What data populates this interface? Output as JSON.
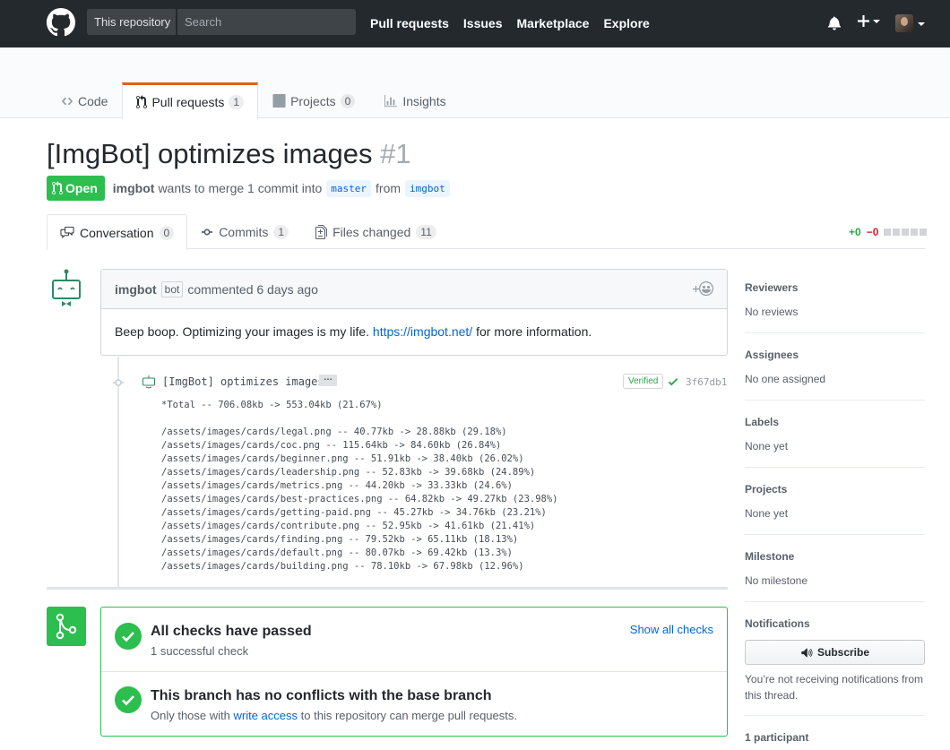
{
  "header": {
    "scope_label": "This repository",
    "search_placeholder": "Search",
    "nav": [
      "Pull requests",
      "Issues",
      "Marketplace",
      "Explore"
    ]
  },
  "repo_tabs": [
    {
      "label": "Code",
      "count": null
    },
    {
      "label": "Pull requests",
      "count": "1"
    },
    {
      "label": "Projects",
      "count": "0"
    },
    {
      "label": "Insights",
      "count": null
    }
  ],
  "pr": {
    "title": "[ImgBot] optimizes images",
    "number": "#1",
    "state": "Open",
    "author": "imgbot",
    "merge_text": "wants to merge 1 commit into",
    "base": "master",
    "from_text": "from",
    "head": "imgbot"
  },
  "pr_tabs": [
    {
      "label": "Conversation",
      "count": "0"
    },
    {
      "label": "Commits",
      "count": "1"
    },
    {
      "label": "Files changed",
      "count": "11"
    }
  ],
  "diffstat": {
    "additions": "+0",
    "deletions": "−0"
  },
  "comment": {
    "author": "imgbot",
    "badge": "bot",
    "time": "commented 6 days ago",
    "body_before": "Beep boop. Optimizing your images is my life.",
    "link": "https://imgbot.net/",
    "body_after": "for more information."
  },
  "commit": {
    "message": "[ImgBot] optimizes images",
    "expander": "…",
    "verified": "Verified",
    "sha": "3f67db1",
    "description": "*Total -- 706.08kb -> 553.04kb (21.67%)\n\n/assets/images/cards/legal.png -- 40.77kb -> 28.88kb (29.18%)\n/assets/images/cards/coc.png -- 115.64kb -> 84.60kb (26.84%)\n/assets/images/cards/beginner.png -- 51.91kb -> 38.40kb (26.02%)\n/assets/images/cards/leadership.png -- 52.83kb -> 39.68kb (24.89%)\n/assets/images/cards/metrics.png -- 44.20kb -> 33.33kb (24.6%)\n/assets/images/cards/best-practices.png -- 64.82kb -> 49.27kb (23.98%)\n/assets/images/cards/getting-paid.png -- 45.27kb -> 34.76kb (23.21%)\n/assets/images/cards/contribute.png -- 52.95kb -> 41.61kb (21.41%)\n/assets/images/cards/finding.png -- 79.52kb -> 65.11kb (18.13%)\n/assets/images/cards/default.png -- 80.07kb -> 69.42kb (13.3%)\n/assets/images/cards/building.png -- 78.10kb -> 67.98kb (12.96%)"
  },
  "merge": {
    "checks_title": "All checks have passed",
    "checks_sub": "1 successful check",
    "show_checks": "Show all checks",
    "conflict_title": "This branch has no conflicts with the base branch",
    "conflict_sub_before": "Only those with",
    "conflict_link": "write access",
    "conflict_sub_after": "to this repository can merge pull requests."
  },
  "sidebar": {
    "reviewers": {
      "title": "Reviewers",
      "value": "No reviews"
    },
    "assignees": {
      "title": "Assignees",
      "value": "No one assigned"
    },
    "labels": {
      "title": "Labels",
      "value": "None yet"
    },
    "projects": {
      "title": "Projects",
      "value": "None yet"
    },
    "milestone": {
      "title": "Milestone",
      "value": "No milestone"
    },
    "notifications": {
      "title": "Notifications",
      "button": "Subscribe",
      "note": "You’re not receiving notifications from this thread."
    },
    "participants": "1 participant"
  },
  "colors": {
    "brand_dark": "#24292e",
    "success": "#2cbe4e",
    "link": "#0366d6",
    "tab_accent": "#e36209"
  },
  "icons": [
    "github-logo-icon",
    "bell-icon",
    "plus-icon",
    "code-icon",
    "pull-request-icon",
    "project-icon",
    "graph-icon",
    "comment-discussion-icon",
    "commit-icon",
    "diff-icon",
    "smiley-icon",
    "check-icon",
    "git-merge-icon",
    "unmute-icon"
  ]
}
